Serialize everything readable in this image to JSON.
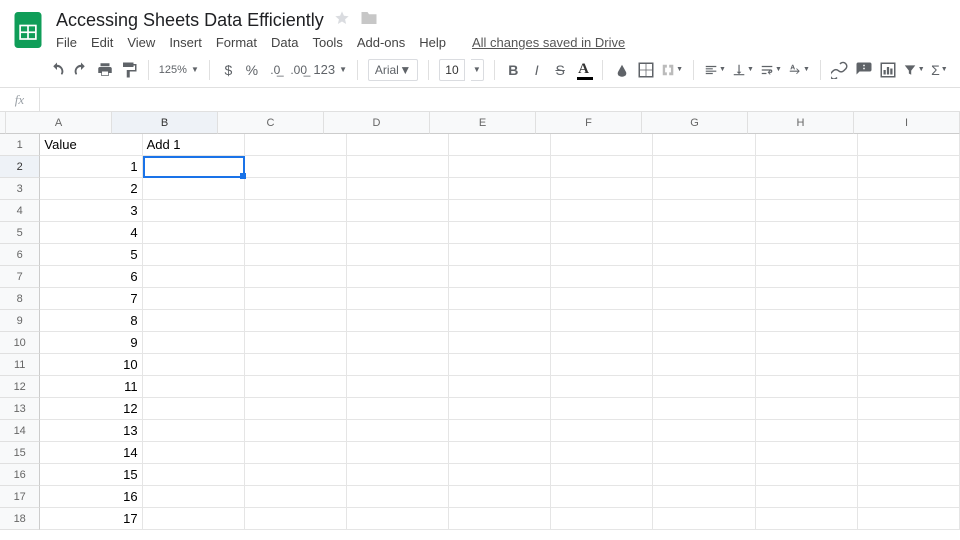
{
  "doc": {
    "title": "Accessing Sheets Data Efficiently",
    "save_status": "All changes saved in Drive"
  },
  "menu": [
    "File",
    "Edit",
    "View",
    "Insert",
    "Format",
    "Data",
    "Tools",
    "Add-ons",
    "Help"
  ],
  "toolbar": {
    "zoom": "125%",
    "font": "Arial",
    "font_size": "10",
    "number_format": "123"
  },
  "formula": {
    "label": "fx",
    "value": ""
  },
  "columns": [
    "A",
    "B",
    "C",
    "D",
    "E",
    "F",
    "G",
    "H",
    "I"
  ],
  "selection": {
    "row": 2,
    "col": "B"
  },
  "rows": [
    {
      "n": 1,
      "A": "Value",
      "B": "Add 1",
      "A_align": "text",
      "B_align": "text"
    },
    {
      "n": 2,
      "A": "1"
    },
    {
      "n": 3,
      "A": "2"
    },
    {
      "n": 4,
      "A": "3"
    },
    {
      "n": 5,
      "A": "4"
    },
    {
      "n": 6,
      "A": "5"
    },
    {
      "n": 7,
      "A": "6"
    },
    {
      "n": 8,
      "A": "7"
    },
    {
      "n": 9,
      "A": "8"
    },
    {
      "n": 10,
      "A": "9"
    },
    {
      "n": 11,
      "A": "10"
    },
    {
      "n": 12,
      "A": "11"
    },
    {
      "n": 13,
      "A": "12"
    },
    {
      "n": 14,
      "A": "13"
    },
    {
      "n": 15,
      "A": "14"
    },
    {
      "n": 16,
      "A": "15"
    },
    {
      "n": 17,
      "A": "16"
    },
    {
      "n": 18,
      "A": "17"
    }
  ]
}
